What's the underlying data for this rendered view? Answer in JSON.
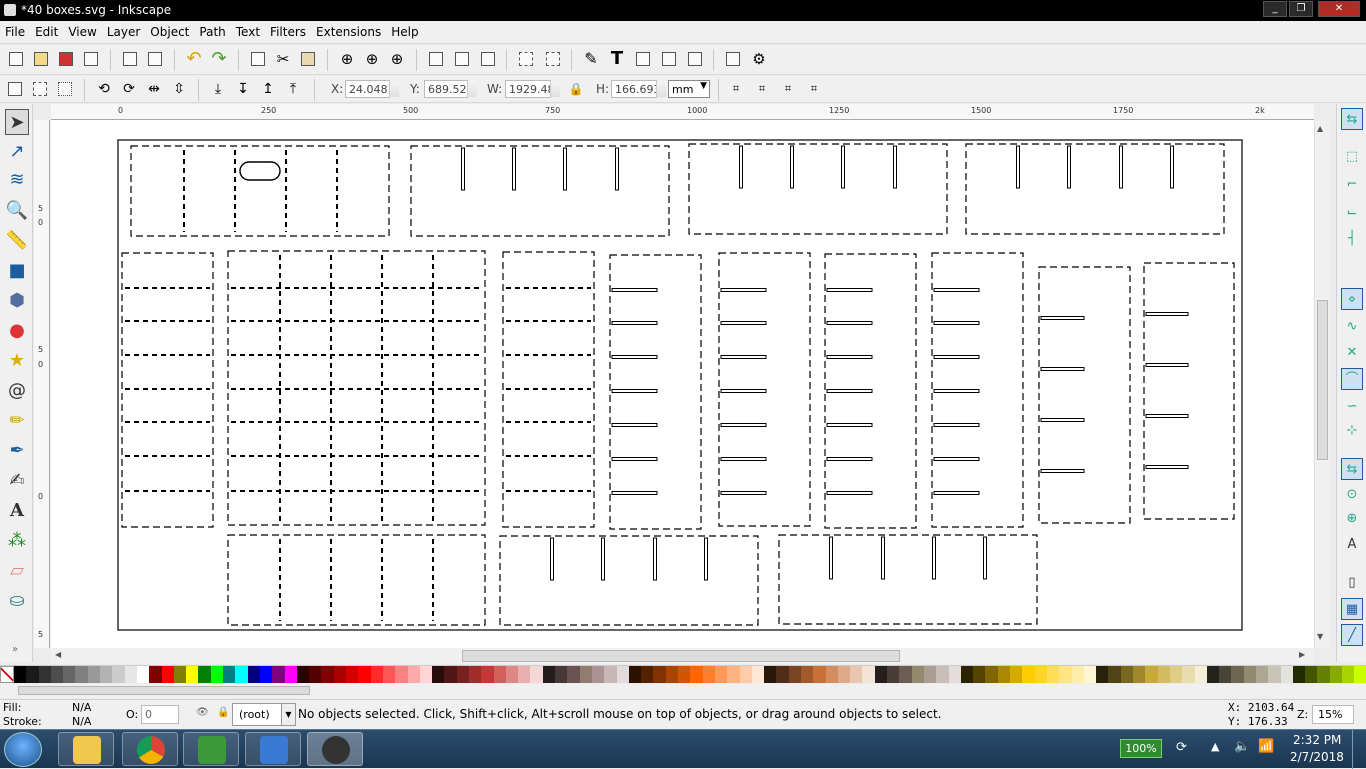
{
  "window": {
    "title": "*40 boxes.svg - Inkscape"
  },
  "menu": [
    "File",
    "Edit",
    "View",
    "Layer",
    "Object",
    "Path",
    "Text",
    "Filters",
    "Extensions",
    "Help"
  ],
  "selector_toolbar": {
    "x_label": "X:",
    "x_value": "24.048",
    "y_label": "Y:",
    "y_value": "689.521",
    "w_label": "W:",
    "w_value": "1929.48",
    "h_label": "H:",
    "h_value": "166.693",
    "unit": "mm"
  },
  "ruler": {
    "labels": [
      "0",
      "250",
      "500",
      "750",
      "1000",
      "1250",
      "1500",
      "1750",
      "2k"
    ]
  },
  "vruler": {
    "labels": [
      "5",
      "0",
      "5",
      "0",
      "0",
      "5"
    ]
  },
  "status": {
    "fill_label": "Fill:",
    "fill_value": "N/A",
    "stroke_label": "Stroke:",
    "stroke_value": "N/A",
    "opacity_label": "O:",
    "opacity_value": "0",
    "layer": "(root)",
    "message": "No objects selected. Click, Shift+click, Alt+scroll mouse on top of objects, or drag around objects to select.",
    "cursor_x": "X: 2103.64",
    "cursor_y": "Y: 176.33",
    "zoom_label": "Z:",
    "zoom_value": "15%"
  },
  "taskbar": {
    "battery": "100%",
    "time": "2:32 PM",
    "date": "2/7/2018"
  },
  "icons": {
    "tools": [
      "selector-icon",
      "node-icon",
      "tweak-icon",
      "zoom-icon",
      "measure-icon",
      "rect-icon",
      "3dbox-icon",
      "ellipse-icon",
      "star-icon",
      "spiral-icon",
      "pencil-icon",
      "pen-icon",
      "calligraphy-icon",
      "text-icon",
      "spray-icon",
      "eraser-icon",
      "bucket-icon"
    ]
  },
  "colors": {
    "palette": [
      "#000000",
      "#1a1a1a",
      "#333333",
      "#4d4d4d",
      "#666666",
      "#808080",
      "#999999",
      "#b3b3b3",
      "#cccccc",
      "#e6e6e6",
      "#ffffff",
      "#800000",
      "#ff0000",
      "#808000",
      "#ffff00",
      "#008000",
      "#00ff00",
      "#008080",
      "#00ffff",
      "#000080",
      "#0000ff",
      "#800080",
      "#ff00ff",
      "#2b0000",
      "#550000",
      "#800000",
      "#aa0000",
      "#d40000",
      "#ff0000",
      "#ff2a2a",
      "#ff5555",
      "#ff8080",
      "#ffaaaa",
      "#ffd5d5",
      "#280b0b",
      "#501616",
      "#782121",
      "#a02c2c",
      "#c83737",
      "#d35f5f",
      "#de8787",
      "#e9afaf",
      "#f4d7d7",
      "#241c1c",
      "#483737",
      "#6c5353",
      "#917c6f",
      "#ac9393",
      "#c8b7b7",
      "#e3dbdb",
      "#2b1100",
      "#552200",
      "#803300",
      "#aa4400",
      "#d45500",
      "#ff6600",
      "#ff7f2a",
      "#ff9955",
      "#ffb380",
      "#ffccaa",
      "#ffe6d5",
      "#28170b",
      "#502d16",
      "#784421",
      "#a05a2c",
      "#c87137",
      "#d38d5f",
      "#deaa87",
      "#e9c6af",
      "#f4e3d7",
      "#241f1c",
      "#483e37",
      "#6c5d53",
      "#918a6f",
      "#ac9d93",
      "#c8beb7",
      "#e3dedb",
      "#2b2200",
      "#554400",
      "#806600",
      "#aa8800",
      "#d4aa00",
      "#ffcc00",
      "#ffd42a",
      "#ffdd55",
      "#ffe680",
      "#ffeeaa",
      "#fff6d5",
      "#28220b",
      "#504416",
      "#786721",
      "#a0892c",
      "#c8ab37",
      "#d3bc5f",
      "#decd87",
      "#e9ddaf",
      "#f4eed7",
      "#24221c",
      "#484537",
      "#6c6753",
      "#918a6f",
      "#aca793",
      "#c8c4b7",
      "#e3e2db",
      "#222b00",
      "#445500",
      "#668000",
      "#88aa00",
      "#aad400",
      "#ccff00"
    ]
  }
}
